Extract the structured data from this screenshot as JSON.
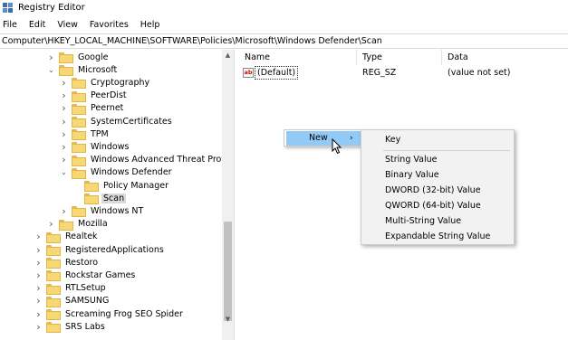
{
  "window": {
    "title": "Registry Editor",
    "icon": "registry-editor-icon"
  },
  "menu": [
    "File",
    "Edit",
    "View",
    "Favorites",
    "Help"
  ],
  "address": "Computer\\HKEY_LOCAL_MACHINE\\SOFTWARE\\Policies\\Microsoft\\Windows Defender\\Scan",
  "tree": {
    "items": [
      {
        "label": "Google",
        "chevron": "right"
      },
      {
        "label": "Microsoft",
        "chevron": "down"
      },
      {
        "label": "Cryptography",
        "chevron": "right"
      },
      {
        "label": "PeerDist",
        "chevron": "right"
      },
      {
        "label": "Peernet",
        "chevron": "right"
      },
      {
        "label": "SystemCertificates",
        "chevron": "right"
      },
      {
        "label": "TPM",
        "chevron": "right"
      },
      {
        "label": "Windows",
        "chevron": "right"
      },
      {
        "label": "Windows Advanced Threat Protectio",
        "chevron": "right"
      },
      {
        "label": "Windows Defender",
        "chevron": "down"
      },
      {
        "label": "Policy Manager",
        "chevron": ""
      },
      {
        "label": "Scan",
        "chevron": "",
        "selected": true
      },
      {
        "label": "Windows NT",
        "chevron": "right"
      },
      {
        "label": "Mozilla",
        "chevron": "right"
      },
      {
        "label": "Realtek",
        "chevron": "right"
      },
      {
        "label": "RegisteredApplications",
        "chevron": "right"
      },
      {
        "label": "Restoro",
        "chevron": "right"
      },
      {
        "label": "Rockstar Games",
        "chevron": "right"
      },
      {
        "label": "RTLSetup",
        "chevron": "right"
      },
      {
        "label": "SAMSUNG",
        "chevron": "right"
      },
      {
        "label": "Screaming Frog SEO Spider",
        "chevron": "right"
      },
      {
        "label": "SRS Labs",
        "chevron": "right"
      }
    ]
  },
  "values": {
    "columns": [
      "Name",
      "Type",
      "Data"
    ],
    "rows": [
      {
        "name": "(Default)",
        "type": "REG_SZ",
        "data": "(value not set)",
        "icon": "ab-string-icon"
      }
    ]
  },
  "context_menu": {
    "item": "New",
    "arrow": "›"
  },
  "submenu": {
    "items": [
      "Key",
      "String Value",
      "Binary Value",
      "DWORD (32-bit) Value",
      "QWORD (64-bit) Value",
      "Multi-String Value",
      "Expandable String Value"
    ]
  },
  "colors": {
    "folder": "#f8d775",
    "menu_highlight": "#91c9f7",
    "selection": "#d9d9d9"
  }
}
